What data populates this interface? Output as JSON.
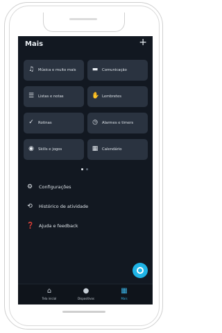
{
  "header": {
    "title": "Mais",
    "add_icon": "plus-icon"
  },
  "tiles": [
    {
      "label": "Música e muito mais",
      "icon": "music-note-icon"
    },
    {
      "label": "Comunicação",
      "icon": "chat-bubble-icon"
    },
    {
      "label": "Listas e notas",
      "icon": "list-icon"
    },
    {
      "label": "Lembretes",
      "icon": "reminder-hand-icon"
    },
    {
      "label": "Rotinas",
      "icon": "routine-check-icon"
    },
    {
      "label": "Alarmes e timers",
      "icon": "alarm-clock-icon"
    },
    {
      "label": "Skills e jogos",
      "icon": "location-pin-icon"
    },
    {
      "label": "Calendário",
      "icon": "calendar-icon"
    }
  ],
  "pager": {
    "pages": 2,
    "current": 1
  },
  "menu": [
    {
      "label": "Configurações",
      "icon": "gear-icon"
    },
    {
      "label": "Histórico de atividade",
      "icon": "history-icon"
    },
    {
      "label": "Ajuda e feedback",
      "icon": "help-icon"
    }
  ],
  "tabs": [
    {
      "label": "Tela inicial",
      "icon": "home-icon",
      "active": false
    },
    {
      "label": "Dispositivos",
      "icon": "device-icon",
      "active": false
    },
    {
      "label": "Mais",
      "icon": "more-grid-icon",
      "active": true
    }
  ],
  "colors": {
    "background": "#121821",
    "tile": "#2a3340",
    "accent": "#1fb4e6",
    "active_tab": "#3ab3e6"
  }
}
